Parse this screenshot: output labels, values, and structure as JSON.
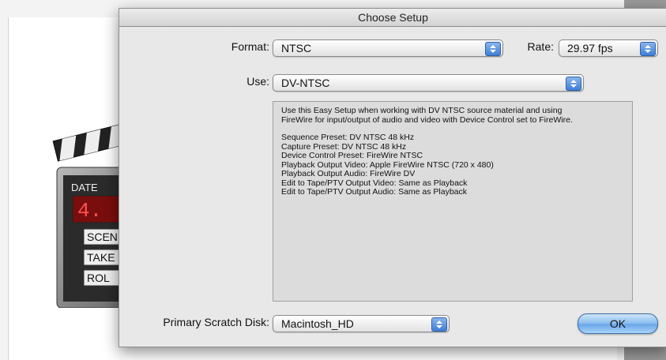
{
  "dialog": {
    "title": "Choose Setup",
    "format_label": "Format:",
    "format_value": "NTSC",
    "rate_label": "Rate:",
    "rate_value": "29.97 fps",
    "use_label": "Use:",
    "use_value": "DV-NTSC",
    "description": {
      "intro_1": "Use this Easy Setup when working with DV NTSC source material and using",
      "intro_2": "FireWire for input/output of audio and video with Device Control set to FireWire.",
      "lines": [
        "Sequence Preset: DV NTSC 48 kHz",
        "Capture Preset: DV NTSC 48 kHz",
        "Device Control Preset: FireWire NTSC",
        "Playback Output Video: Apple FireWire NTSC (720 x 480)",
        "Playback Output Audio: FireWire DV",
        "Edit to Tape/PTV Output Video: Same as Playback",
        "Edit to Tape/PTV Output Audio: Same as Playback"
      ]
    },
    "scratch_label": "Primary Scratch Disk:",
    "scratch_value": "Macintosh_HD",
    "ok_label": "OK"
  },
  "clapper": {
    "labels": [
      "DATE",
      "SCEN",
      "TAKE",
      "ROL"
    ],
    "display": "4."
  },
  "colors": {
    "accent": "#6aa8e8",
    "arrow_button": "#3f7fd6"
  }
}
